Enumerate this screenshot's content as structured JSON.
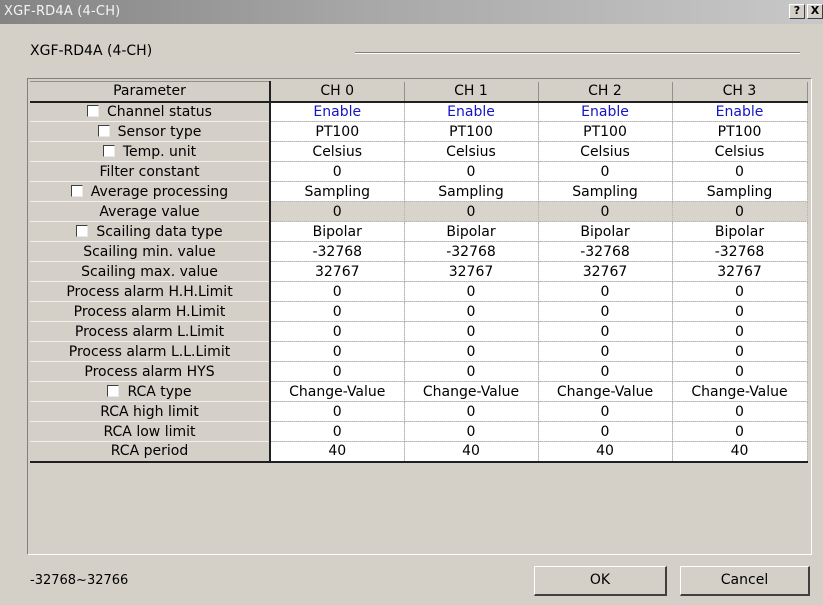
{
  "window": {
    "title": "XGF-RD4A (4-CH)",
    "help_label": "?",
    "close_label": "X"
  },
  "group": {
    "label": "XGF-RD4A (4-CH)"
  },
  "table": {
    "columns": [
      "Parameter",
      "CH 0",
      "CH 1",
      "CH 2",
      "CH 3"
    ],
    "rows": [
      {
        "label": "Channel status",
        "checkbox": true,
        "values": [
          "Enable",
          "Enable",
          "Enable",
          "Enable"
        ],
        "value_color": "#1414c8"
      },
      {
        "label": "Sensor type",
        "checkbox": true,
        "values": [
          "PT100",
          "PT100",
          "PT100",
          "PT100"
        ]
      },
      {
        "label": "Temp. unit",
        "checkbox": true,
        "values": [
          "Celsius",
          "Celsius",
          "Celsius",
          "Celsius"
        ]
      },
      {
        "label": "Filter constant",
        "checkbox": false,
        "values": [
          "0",
          "0",
          "0",
          "0"
        ]
      },
      {
        "label": "Average processing",
        "checkbox": true,
        "values": [
          "Sampling",
          "Sampling",
          "Sampling",
          "Sampling"
        ]
      },
      {
        "label": "Average value",
        "checkbox": false,
        "values": [
          "0",
          "0",
          "0",
          "0"
        ],
        "read_only": true
      },
      {
        "label": "Scailing data type",
        "checkbox": true,
        "values": [
          "Bipolar",
          "Bipolar",
          "Bipolar",
          "Bipolar"
        ]
      },
      {
        "label": "Scailing min. value",
        "checkbox": false,
        "values": [
          "-32768",
          "-32768",
          "-32768",
          "-32768"
        ]
      },
      {
        "label": "Scailing max. value",
        "checkbox": false,
        "values": [
          "32767",
          "32767",
          "32767",
          "32767"
        ]
      },
      {
        "label": "Process alarm H.H.Limit",
        "checkbox": false,
        "values": [
          "0",
          "0",
          "0",
          "0"
        ]
      },
      {
        "label": "Process alarm H.Limit",
        "checkbox": false,
        "values": [
          "0",
          "0",
          "0",
          "0"
        ]
      },
      {
        "label": "Process alarm L.Limit",
        "checkbox": false,
        "values": [
          "0",
          "0",
          "0",
          "0"
        ]
      },
      {
        "label": "Process alarm L.L.Limit",
        "checkbox": false,
        "values": [
          "0",
          "0",
          "0",
          "0"
        ]
      },
      {
        "label": "Process alarm HYS",
        "checkbox": false,
        "values": [
          "0",
          "0",
          "0",
          "0"
        ]
      },
      {
        "label": "RCA type",
        "checkbox": true,
        "values": [
          "Change-Value",
          "Change-Value",
          "Change-Value",
          "Change-Value"
        ]
      },
      {
        "label": "RCA high limit",
        "checkbox": false,
        "values": [
          "0",
          "0",
          "0",
          "0"
        ]
      },
      {
        "label": "RCA low limit",
        "checkbox": false,
        "values": [
          "0",
          "0",
          "0",
          "0"
        ]
      },
      {
        "label": "RCA period",
        "checkbox": false,
        "values": [
          "40",
          "40",
          "40",
          "40"
        ]
      }
    ]
  },
  "footer": {
    "range_text": "-32768~32766",
    "ok_label": "OK",
    "cancel_label": "Cancel"
  }
}
